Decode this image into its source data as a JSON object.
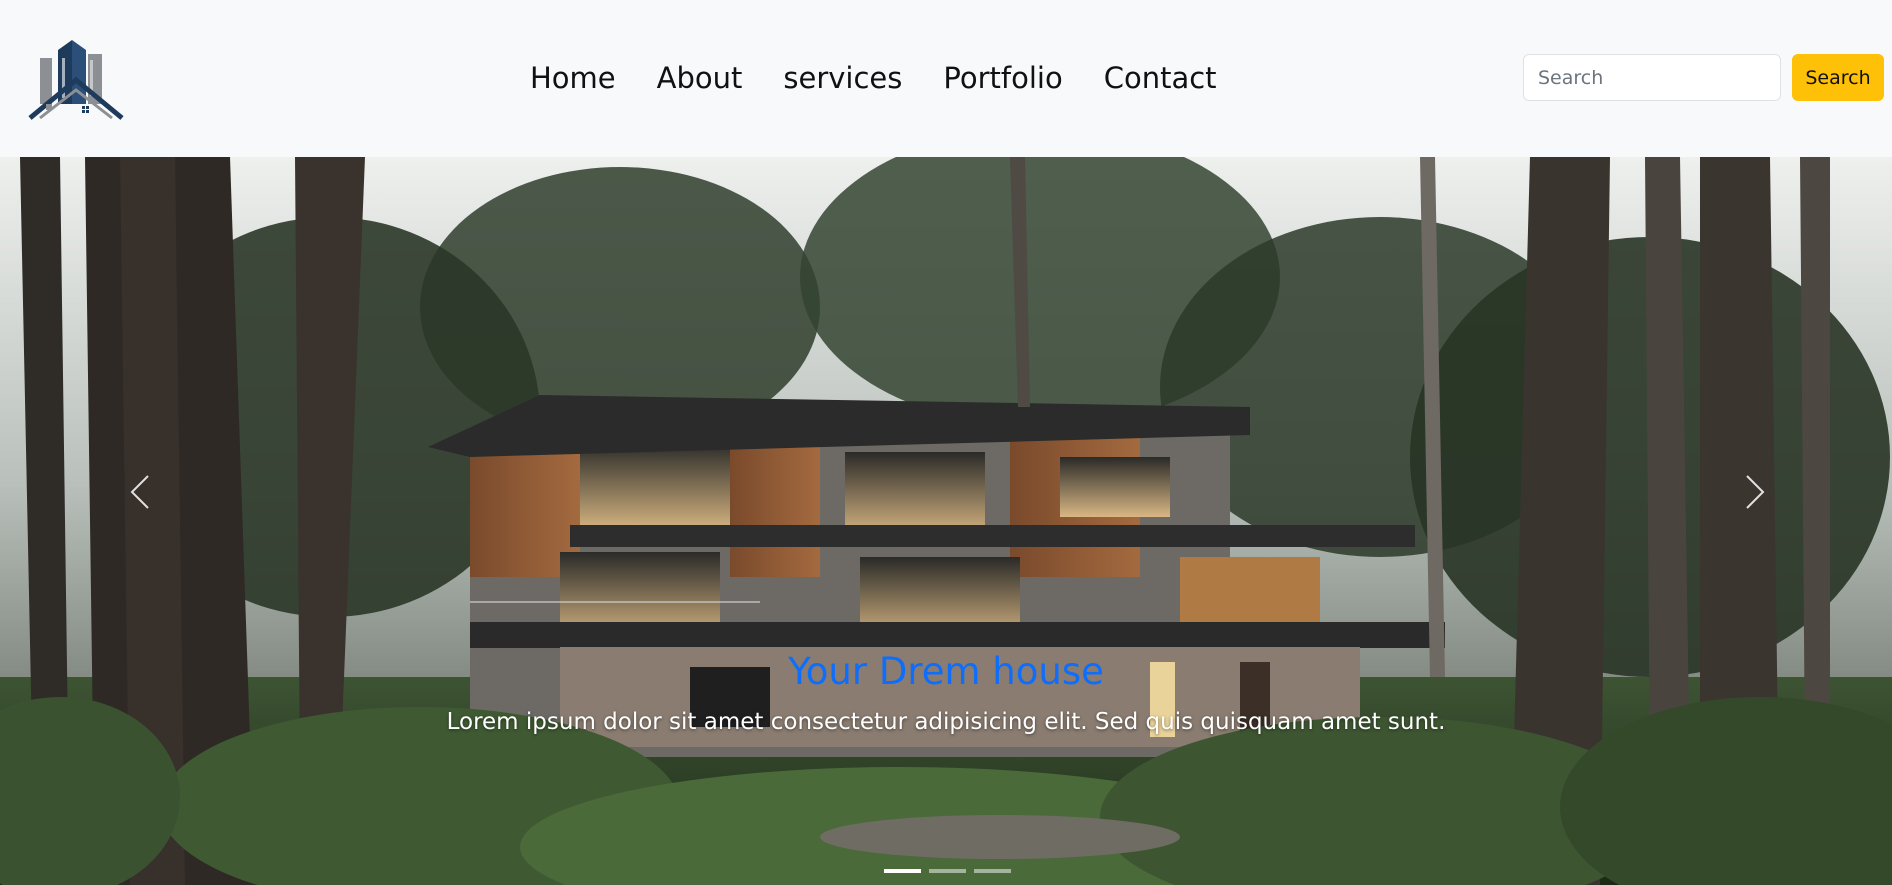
{
  "nav": {
    "links": [
      "Home",
      "About",
      "services",
      "Portfolio",
      "Contact"
    ],
    "search_placeholder": "Search",
    "search_button": "Search"
  },
  "hero": {
    "title": "Your Drem house",
    "text": "Lorem ipsum dolor sit amet consectetur adipisicing elit. Sed quis quisquam amet sunt.",
    "slide_count": 3,
    "active_slide": 0
  },
  "colors": {
    "navbar_bg": "#f8f9fa",
    "accent_button": "#ffc107",
    "title_color": "#0d6efd",
    "logo_blue": "#1f3b5c"
  },
  "icons": {
    "prev": "chevron-left-icon",
    "next": "chevron-right-icon",
    "logo": "building-house-logo"
  }
}
